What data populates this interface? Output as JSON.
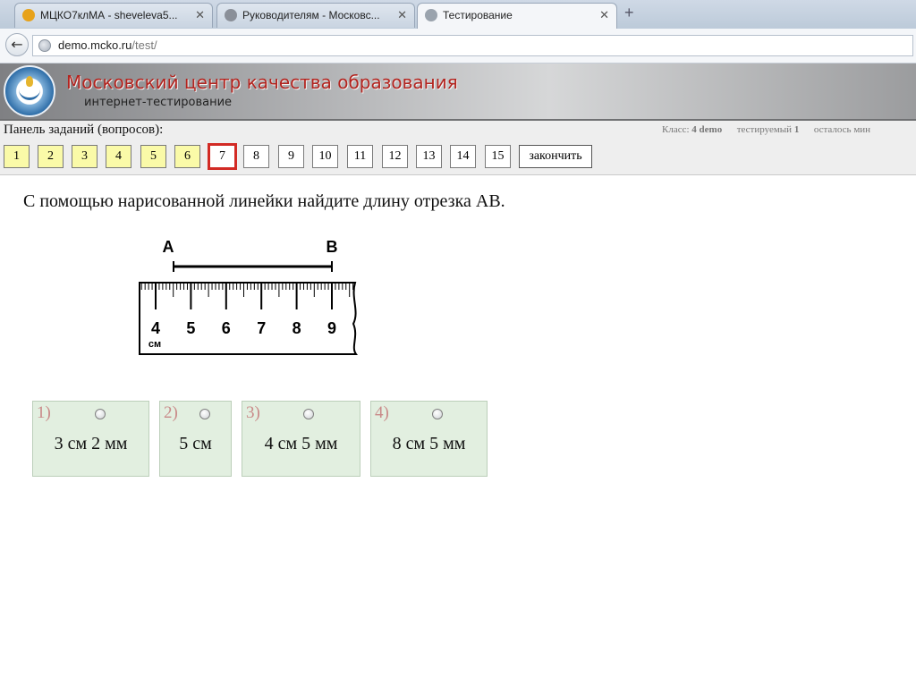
{
  "browser": {
    "tabs": [
      {
        "title": "МЦКО7клМА - sheveleva5...",
        "favicon_color": "#e7a21a"
      },
      {
        "title": "Руководителям - Московс...",
        "favicon_color": "#8a8f98"
      },
      {
        "title": "Тестирование",
        "favicon_color": "#9aa3ad"
      }
    ],
    "close_glyph": "✕",
    "newtab_glyph": "+",
    "back_glyph": "←",
    "url_host": "demo.mcko.ru",
    "url_path": "/test/"
  },
  "site": {
    "title": "Московский центр качества образования",
    "subtitle": "интернет-тестирование"
  },
  "panel": {
    "label": "Панель заданий (вопросов):",
    "info_class_label": "Класс:",
    "info_class_value": "4 demo",
    "info_tested_label": "тестируемый",
    "info_tested_value": "1",
    "info_remaining": "осталось мин",
    "questions": [
      {
        "label": "1",
        "state": "answered"
      },
      {
        "label": "2",
        "state": "answered"
      },
      {
        "label": "3",
        "state": "answered"
      },
      {
        "label": "4",
        "state": "answered"
      },
      {
        "label": "5",
        "state": "answered"
      },
      {
        "label": "6",
        "state": "answered"
      },
      {
        "label": "7",
        "state": "current"
      },
      {
        "label": "8",
        "state": "unanswered"
      },
      {
        "label": "9",
        "state": "unanswered"
      },
      {
        "label": "10",
        "state": "unanswered"
      },
      {
        "label": "11",
        "state": "unanswered"
      },
      {
        "label": "12",
        "state": "unanswered"
      },
      {
        "label": "13",
        "state": "unanswered"
      },
      {
        "label": "14",
        "state": "unanswered"
      },
      {
        "label": "15",
        "state": "unanswered"
      }
    ],
    "finish_label": "закончить"
  },
  "question": {
    "text": "С помощью нарисованной линейки найдите длину отрезка AB.",
    "figure": {
      "point_a": "A",
      "point_b": "B",
      "ruler_numbers": [
        "4",
        "5",
        "6",
        "7",
        "8",
        "9"
      ],
      "unit": "см"
    }
  },
  "answers": [
    {
      "num": "1)",
      "text": "3 см 2 мм"
    },
    {
      "num": "2)",
      "text": "5 см"
    },
    {
      "num": "3)",
      "text": "4 см 5 мм"
    },
    {
      "num": "4)",
      "text": "8 см 5 мм"
    }
  ]
}
